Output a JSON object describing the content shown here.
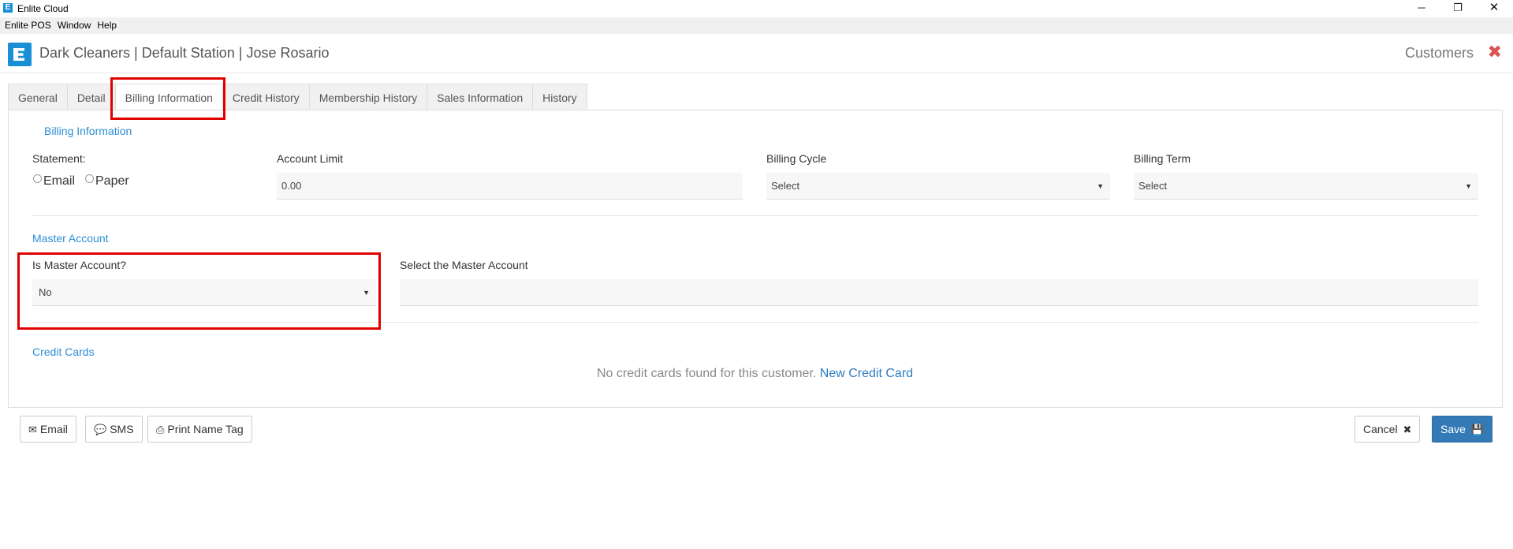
{
  "window": {
    "title": "Enlite Cloud",
    "icon": "E",
    "controls": {
      "minimize": "─",
      "maximize": "❐",
      "close": "✕"
    }
  },
  "menu": [
    "Enlite POS",
    "Window",
    "Help"
  ],
  "header": {
    "breadcrumb": "Dark Cleaners | Default Station | Jose Rosario",
    "section": "Customers",
    "close_glyph": "✖"
  },
  "tabs": [
    {
      "label": "General",
      "active": false
    },
    {
      "label": "Detail",
      "active": false
    },
    {
      "label": "Billing Information",
      "active": true
    },
    {
      "label": "Credit History",
      "active": false
    },
    {
      "label": "Membership History",
      "active": false
    },
    {
      "label": "Sales Information",
      "active": false
    },
    {
      "label": "History",
      "active": false
    }
  ],
  "billing": {
    "title": "Billing Information",
    "statement_label": "Statement:",
    "statement_options": [
      "Email",
      "Paper"
    ],
    "account_limit_label": "Account Limit",
    "account_limit_value": "0.00",
    "billing_cycle_label": "Billing Cycle",
    "billing_cycle_value": "Select",
    "billing_term_label": "Billing Term",
    "billing_term_value": "Select"
  },
  "master": {
    "title": "Master Account",
    "is_master_label": "Is Master Account?",
    "is_master_value": "No",
    "select_master_label": "Select the Master Account",
    "select_master_value": ""
  },
  "credit_cards": {
    "title": "Credit Cards",
    "empty_message": "No credit cards found for this customer.",
    "new_link": "New Credit Card"
  },
  "footer": {
    "email_label": "Email",
    "sms_label": "SMS",
    "print_label": "Print Name Tag",
    "cancel_label": "Cancel",
    "save_label": "Save"
  },
  "colors": {
    "accent": "#2d8fd5",
    "brand": "#1a8fd6",
    "primary_button": "#337ab7",
    "highlight": "#e00000",
    "close": "#d9534f"
  }
}
